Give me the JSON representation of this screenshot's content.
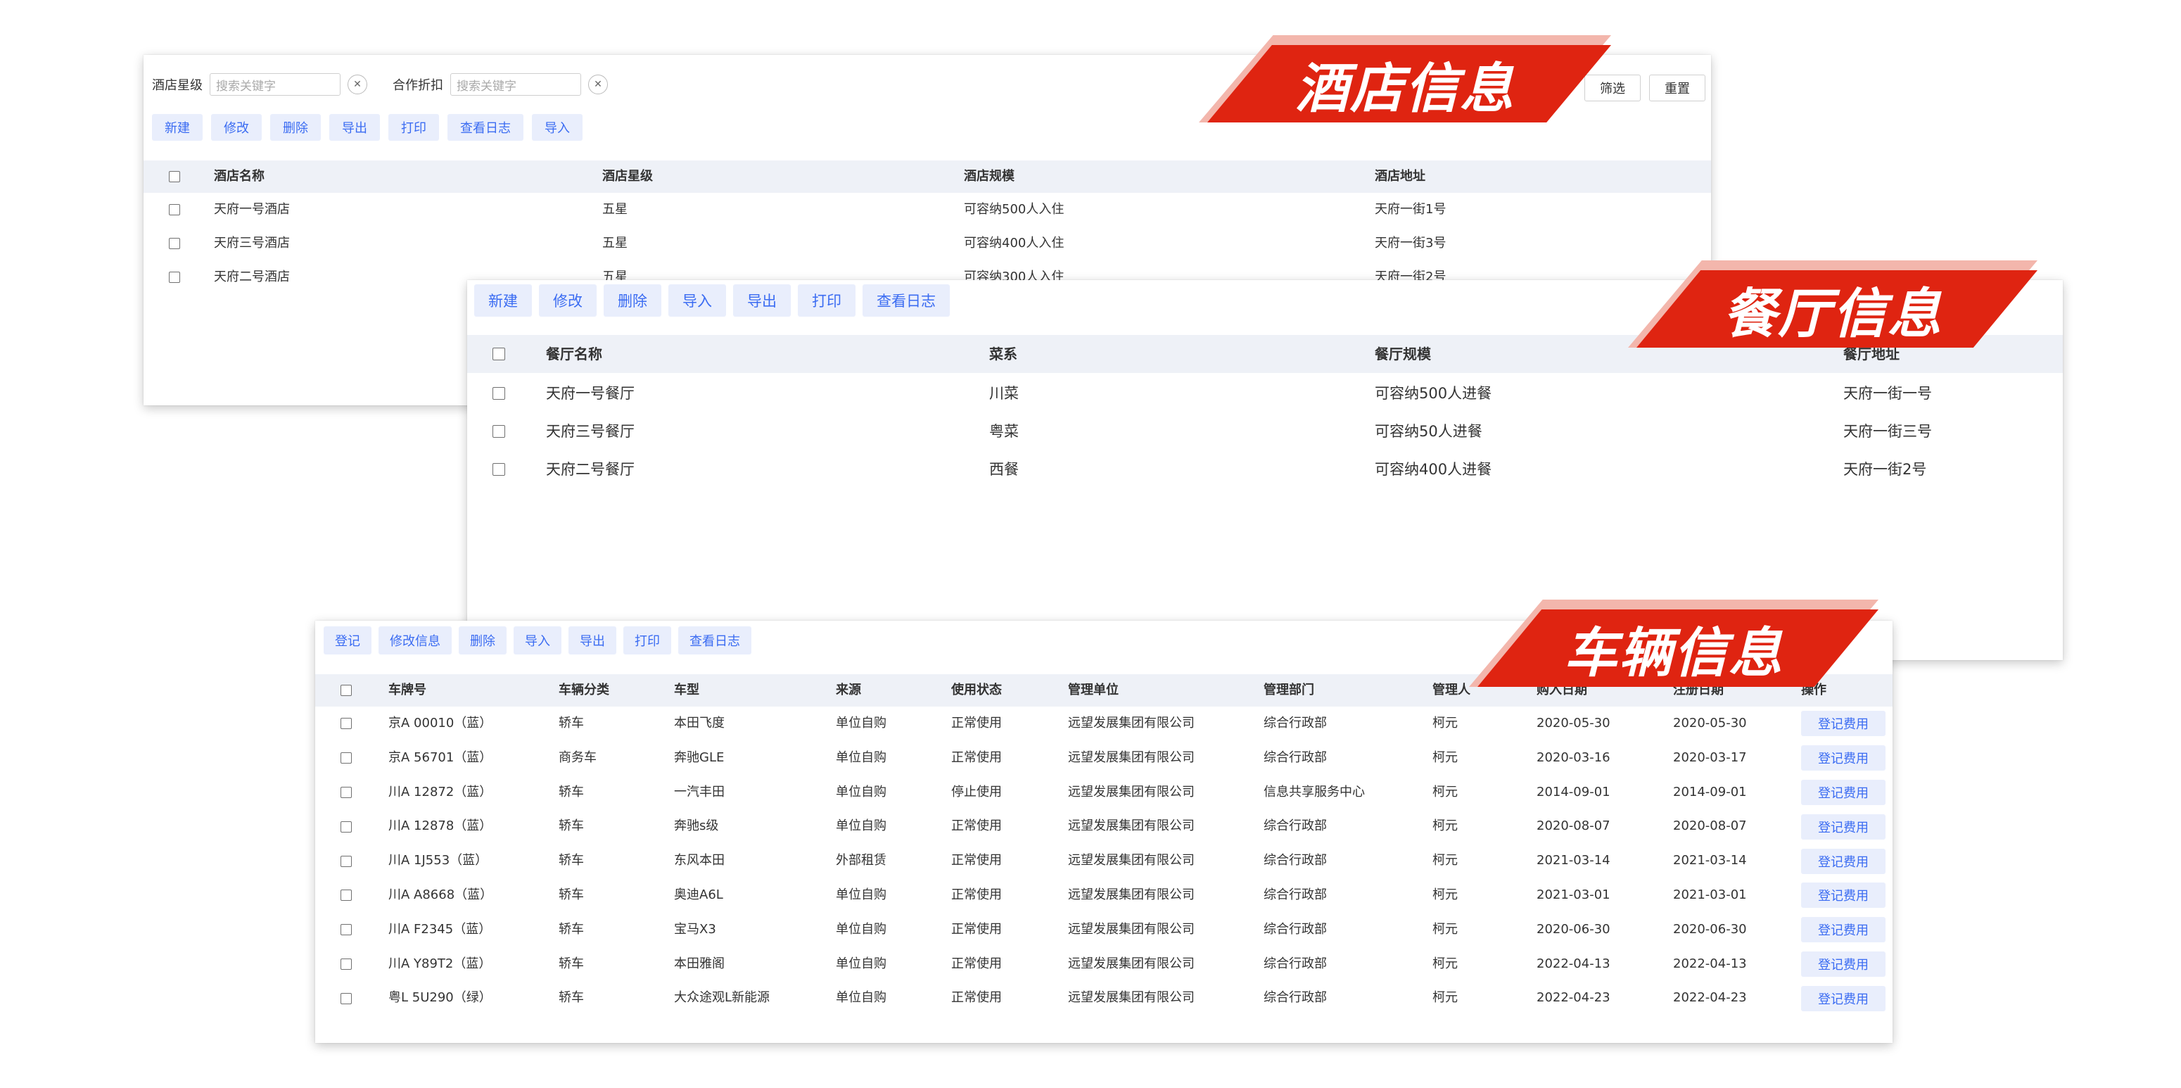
{
  "hotel": {
    "banner": "酒店信息",
    "filters": [
      {
        "label": "酒店星级",
        "placeholder": "搜索关键字"
      },
      {
        "label": "合作折扣",
        "placeholder": "搜索关键字"
      }
    ],
    "filter_button": "筛选",
    "reset_button": "重置",
    "toolbar": [
      "新建",
      "修改",
      "删除",
      "导出",
      "打印",
      "查看日志",
      "导入"
    ],
    "columns": [
      "酒店名称",
      "酒店星级",
      "酒店规模",
      "酒店地址"
    ],
    "rows": [
      [
        "天府一号酒店",
        "五星",
        "可容纳500人入住",
        "天府一街1号"
      ],
      [
        "天府三号酒店",
        "五星",
        "可容纳400人入住",
        "天府一街3号"
      ],
      [
        "天府二号酒店",
        "五星",
        "可容纳300人入住",
        "天府一街2号"
      ]
    ]
  },
  "restaurant": {
    "banner": "餐厅信息",
    "toolbar": [
      "新建",
      "修改",
      "删除",
      "导入",
      "导出",
      "打印",
      "查看日志"
    ],
    "columns": [
      "餐厅名称",
      "菜系",
      "餐厅规模",
      "餐厅地址"
    ],
    "rows": [
      [
        "天府一号餐厅",
        "川菜",
        "可容纳500人进餐",
        "天府一街一号"
      ],
      [
        "天府三号餐厅",
        "粤菜",
        "可容纳50人进餐",
        "天府一街三号"
      ],
      [
        "天府二号餐厅",
        "西餐",
        "可容纳400人进餐",
        "天府一街2号"
      ]
    ]
  },
  "vehicle": {
    "banner": "车辆信息",
    "toolbar": [
      "登记",
      "修改信息",
      "删除",
      "导入",
      "导出",
      "打印",
      "查看日志"
    ],
    "columns": [
      "车牌号",
      "车辆分类",
      "车型",
      "来源",
      "使用状态",
      "管理单位",
      "管理部门",
      "管理人",
      "购入日期",
      "注册日期",
      "操作"
    ],
    "action_label": "登记费用",
    "rows": [
      [
        "京A 00010（蓝）",
        "轿车",
        "本田飞度",
        "单位自购",
        "正常使用",
        "远望发展集团有限公司",
        "综合行政部",
        "柯元",
        "2020-05-30",
        "2020-05-30"
      ],
      [
        "京A 56701（蓝）",
        "商务车",
        "奔驰GLE",
        "单位自购",
        "正常使用",
        "远望发展集团有限公司",
        "综合行政部",
        "柯元",
        "2020-03-16",
        "2020-03-17"
      ],
      [
        "川A 12872（蓝）",
        "轿车",
        "一汽丰田",
        "单位自购",
        "停止使用",
        "远望发展集团有限公司",
        "信息共享服务中心",
        "柯元",
        "2014-09-01",
        "2014-09-01"
      ],
      [
        "川A 12878（蓝）",
        "轿车",
        "奔驰s级",
        "单位自购",
        "正常使用",
        "远望发展集团有限公司",
        "综合行政部",
        "柯元",
        "2020-08-07",
        "2020-08-07"
      ],
      [
        "川A 1J553（蓝）",
        "轿车",
        "东风本田",
        "外部租赁",
        "正常使用",
        "远望发展集团有限公司",
        "综合行政部",
        "柯元",
        "2021-03-14",
        "2021-03-14"
      ],
      [
        "川A A8668（蓝）",
        "轿车",
        "奥迪A6L",
        "单位自购",
        "正常使用",
        "远望发展集团有限公司",
        "综合行政部",
        "柯元",
        "2021-03-01",
        "2021-03-01"
      ],
      [
        "川A F2345（蓝）",
        "轿车",
        "宝马X3",
        "单位自购",
        "正常使用",
        "远望发展集团有限公司",
        "综合行政部",
        "柯元",
        "2020-06-30",
        "2020-06-30"
      ],
      [
        "川A Y89T2（蓝）",
        "轿车",
        "本田雅阁",
        "单位自购",
        "正常使用",
        "远望发展集团有限公司",
        "综合行政部",
        "柯元",
        "2022-04-13",
        "2022-04-13"
      ],
      [
        "粤L 5U290（绿）",
        "轿车",
        "大众途观L新能源",
        "单位自购",
        "正常使用",
        "远望发展集团有限公司",
        "综合行政部",
        "柯元",
        "2022-04-23",
        "2022-04-23"
      ]
    ]
  },
  "colors": {
    "banner_red": "#df2411",
    "banner_shadow": "#f3b6ac",
    "accent_blue": "#3b6cf2",
    "button_bg": "#e9eefc",
    "header_bg": "#eef1f7"
  }
}
